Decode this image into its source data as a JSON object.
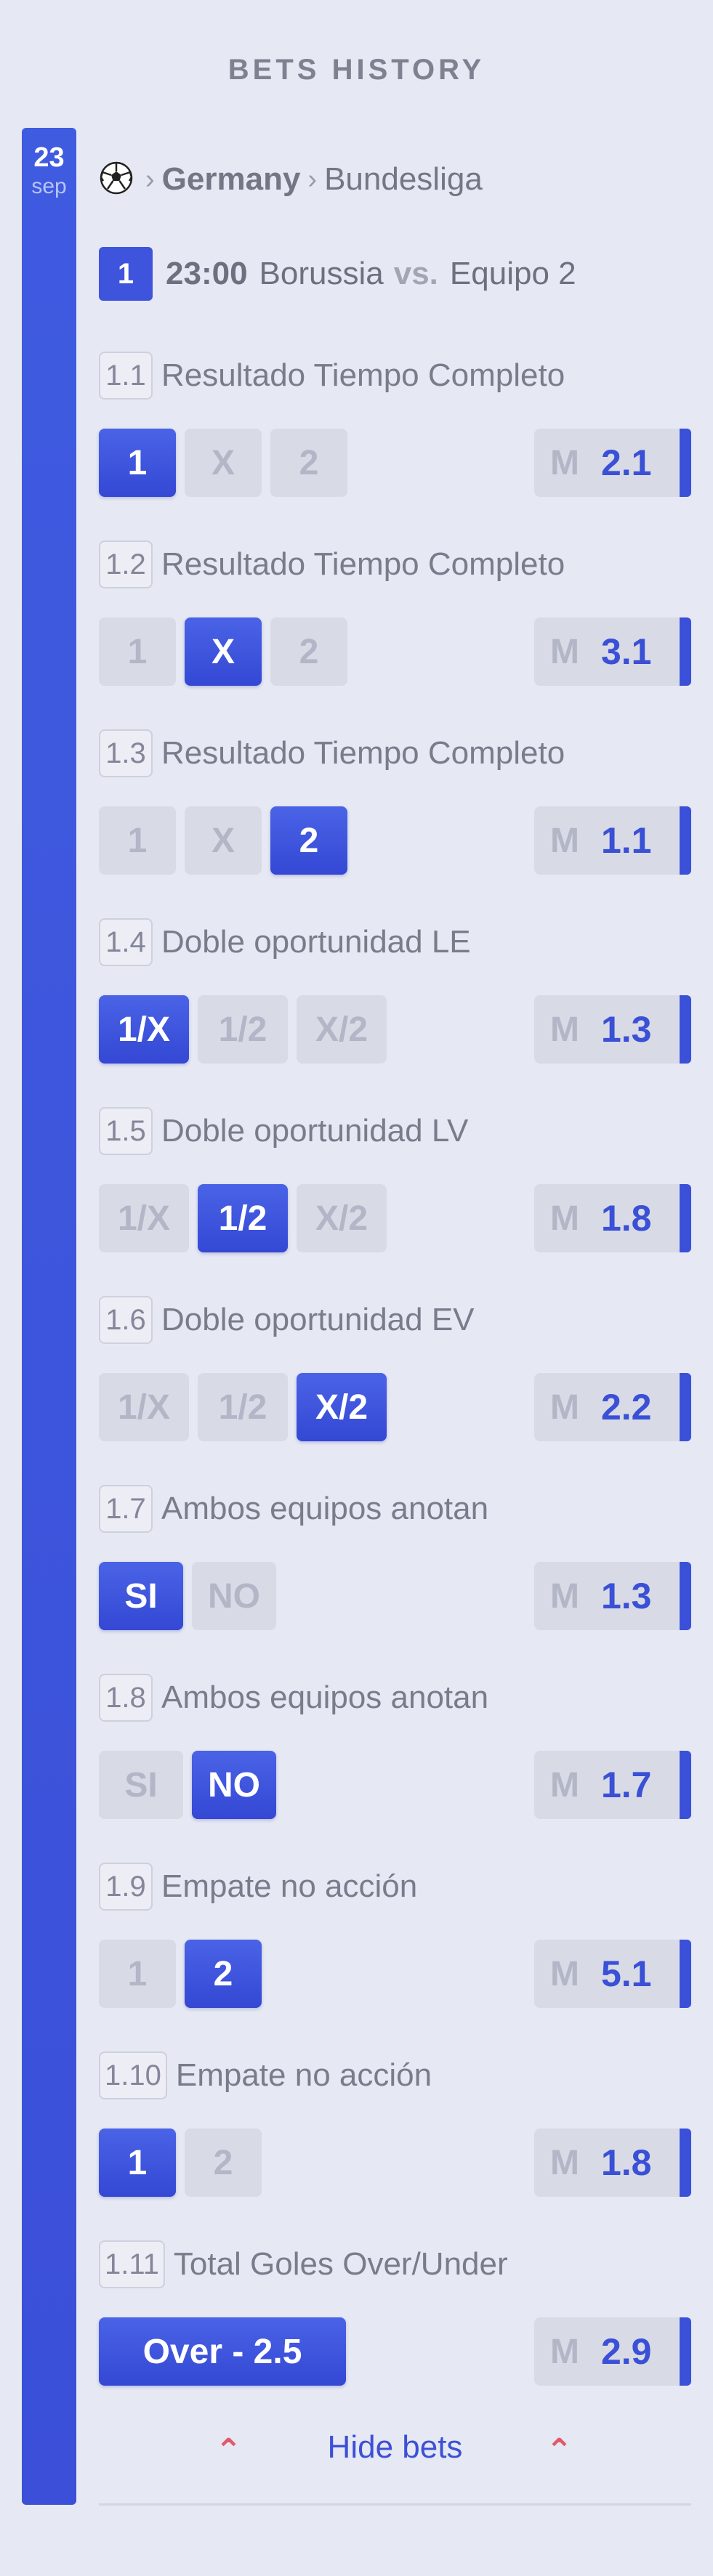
{
  "page_title": "BETS HISTORY",
  "date": {
    "day": "23",
    "month": "sep"
  },
  "breadcrumb": {
    "country": "Germany",
    "league": "Bundesliga"
  },
  "match": {
    "number": "1",
    "time": "23:00",
    "home": "Borussia",
    "vs": "vs.",
    "away": "Equipo 2"
  },
  "bets": [
    {
      "id": "1.1",
      "name": "Resultado Tiempo Completo",
      "options": [
        "1",
        "X",
        "2"
      ],
      "selected": 0,
      "odds_label": "M",
      "odds": "2.1"
    },
    {
      "id": "1.2",
      "name": "Resultado Tiempo Completo",
      "options": [
        "1",
        "X",
        "2"
      ],
      "selected": 1,
      "odds_label": "M",
      "odds": "3.1"
    },
    {
      "id": "1.3",
      "name": "Resultado Tiempo Completo",
      "options": [
        "1",
        "X",
        "2"
      ],
      "selected": 2,
      "odds_label": "M",
      "odds": "1.1"
    },
    {
      "id": "1.4",
      "name": "Doble oportunidad LE",
      "options": [
        "1/X",
        "1/2",
        "X/2"
      ],
      "selected": 0,
      "odds_label": "M",
      "odds": "1.3"
    },
    {
      "id": "1.5",
      "name": "Doble oportunidad LV",
      "options": [
        "1/X",
        "1/2",
        "X/2"
      ],
      "selected": 1,
      "odds_label": "M",
      "odds": "1.8"
    },
    {
      "id": "1.6",
      "name": "Doble oportunidad EV",
      "options": [
        "1/X",
        "1/2",
        "X/2"
      ],
      "selected": 2,
      "odds_label": "M",
      "odds": "2.2"
    },
    {
      "id": "1.7",
      "name": "Ambos equipos anotan",
      "options": [
        "SI",
        "NO"
      ],
      "selected": 0,
      "odds_label": "M",
      "odds": "1.3"
    },
    {
      "id": "1.8",
      "name": "Ambos equipos anotan",
      "options": [
        "SI",
        "NO"
      ],
      "selected": 1,
      "odds_label": "M",
      "odds": "1.7"
    },
    {
      "id": "1.9",
      "name": "Empate no acción",
      "options": [
        "1",
        "2"
      ],
      "selected": 1,
      "odds_label": "M",
      "odds": "5.1"
    },
    {
      "id": "1.10",
      "name": "Empate no acción",
      "options": [
        "1",
        "2"
      ],
      "selected": 0,
      "odds_label": "M",
      "odds": "1.8"
    },
    {
      "id": "1.11",
      "name": "Total Goles Over/Under",
      "options": [
        "Over - 2.5"
      ],
      "selected": 0,
      "odds_label": "M",
      "odds": "2.9"
    }
  ],
  "footer": {
    "hide_label": "Hide bets"
  },
  "colors": {
    "accent": "#3b50d8",
    "caret": "#e05a6a",
    "background": "#e6e8f3"
  }
}
